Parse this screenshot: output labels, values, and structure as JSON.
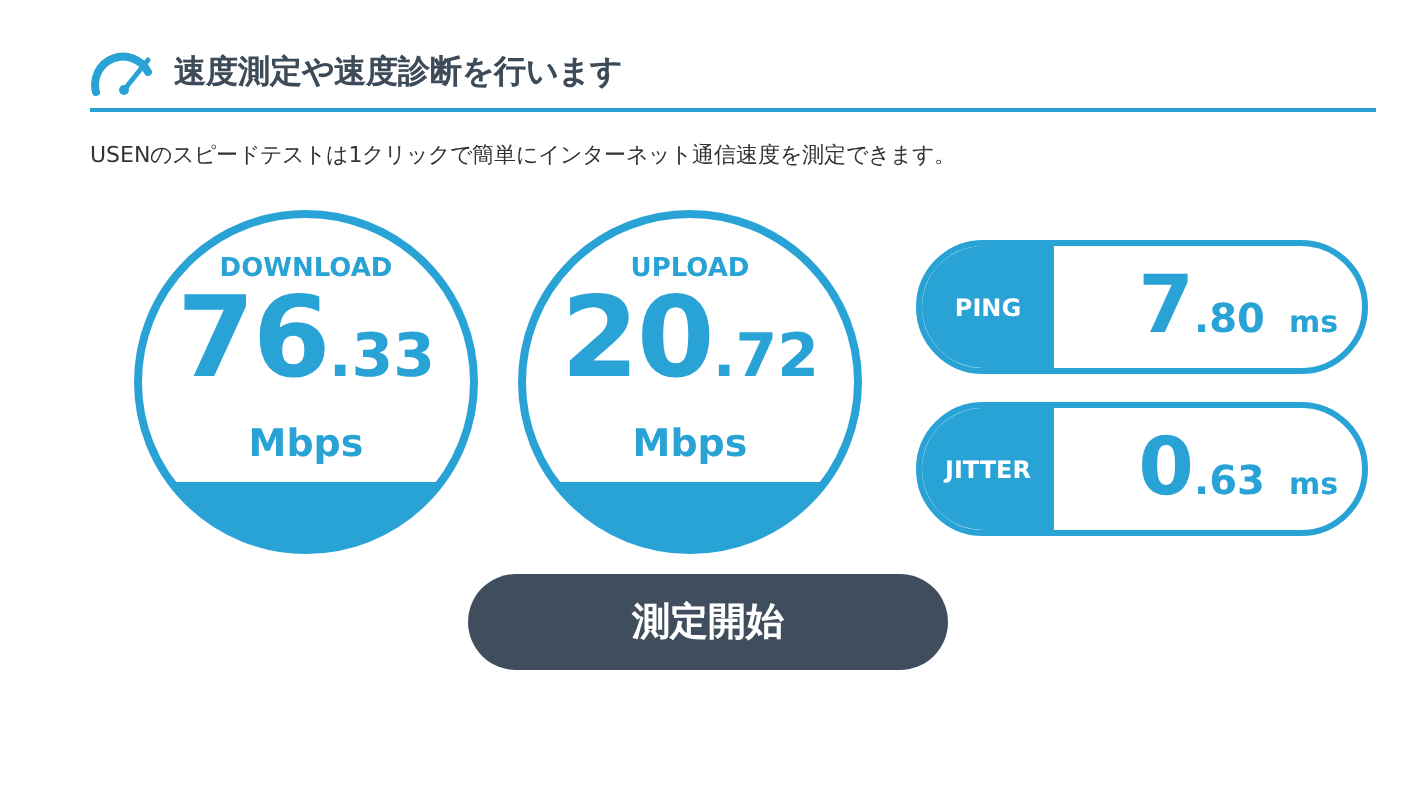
{
  "header": {
    "title": "速度測定や速度診断を行います"
  },
  "description": "USENのスピードテストは1クリックで簡単にインターネット通信速度を測定できます。",
  "gauges": [
    {
      "label": "DOWNLOAD",
      "integer": "76",
      "decimal": ".33",
      "unit": "Mbps"
    },
    {
      "label": "UPLOAD",
      "integer": "20",
      "decimal": ".72",
      "unit": "Mbps"
    }
  ],
  "metrics": [
    {
      "label": "PING",
      "integer": "7",
      "decimal": ".80",
      "unit": "ms"
    },
    {
      "label": "JITTER",
      "integer": "0",
      "decimal": ".63",
      "unit": "ms"
    }
  ],
  "start_button": "測定開始"
}
